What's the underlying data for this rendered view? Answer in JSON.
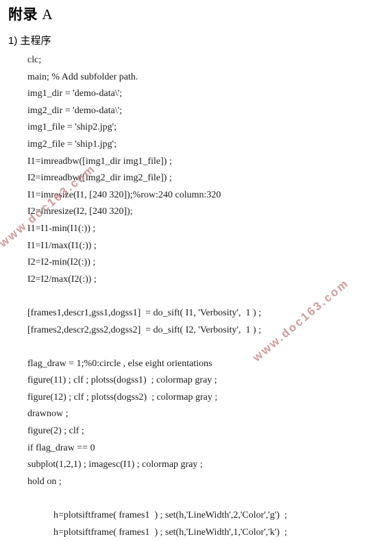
{
  "document": {
    "title_cjk": "附录",
    "title_latin": "A",
    "section_heading": "1) 主程序",
    "code_lines": [
      {
        "text": "clc;",
        "indent": false
      },
      {
        "text": "main; % Add subfolder path.",
        "indent": false
      },
      {
        "text": "img1_dir = 'demo-data\\';",
        "indent": false
      },
      {
        "text": "img2_dir = 'demo-data\\';",
        "indent": false
      },
      {
        "text": "img1_file = 'ship2.jpg';",
        "indent": false
      },
      {
        "text": "img2_file = 'ship1.jpg';",
        "indent": false
      },
      {
        "text": "I1=imreadbw([img1_dir img1_file]) ;",
        "indent": false
      },
      {
        "text": "I2=imreadbw([img2_dir img2_file]) ;",
        "indent": false
      },
      {
        "text": "I1=imresize(I1, [240 320]);%row:240 column:320",
        "indent": false
      },
      {
        "text": "I2=imresize(I2, [240 320]);",
        "indent": false
      },
      {
        "text": "I1=I1-min(I1(:)) ;",
        "indent": false
      },
      {
        "text": "I1=I1/max(I1(:)) ;",
        "indent": false
      },
      {
        "text": "I2=I2-min(I2(:)) ;",
        "indent": false
      },
      {
        "text": "I2=I2/max(I2(:)) ;",
        "indent": false
      },
      {
        "text": "",
        "indent": false
      },
      {
        "text": "[frames1,descr1,gss1,dogss1]  = do_sift( I1, 'Verbosity',  1 ) ;",
        "indent": false
      },
      {
        "text": "[frames2,descr2,gss2,dogss2]  = do_sift( I2, 'Verbosity',  1 ) ;",
        "indent": false
      },
      {
        "text": "",
        "indent": false
      },
      {
        "text": "flag_draw = 1;%0:circle , else eight orientations",
        "indent": false
      },
      {
        "text": "figure(11) ; clf ; plotss(dogss1)  ; colormap gray ;",
        "indent": false
      },
      {
        "text": "figure(12) ; clf ; plotss(dogss2)  ; colormap gray ;",
        "indent": false
      },
      {
        "text": "drawnow ;",
        "indent": false
      },
      {
        "text": "figure(2) ; clf ;",
        "indent": false
      },
      {
        "text": "if flag_draw == 0",
        "indent": false
      },
      {
        "text": "subplot(1,2,1) ; imagesc(I1) ; colormap gray ;",
        "indent": false
      },
      {
        "text": "hold on ;",
        "indent": false
      },
      {
        "text": "",
        "indent": false
      },
      {
        "text": "h=plotsiftframe( frames1  ) ; set(h,'LineWidth',2,'Color','g')  ;",
        "indent": true
      },
      {
        "text": "h=plotsiftframe( frames1  ) ; set(h,'LineWidth',1,'Color','k')  ;",
        "indent": true
      }
    ]
  },
  "watermarks": [
    {
      "text": "www.doc163.com"
    },
    {
      "text": "www.doc163.com"
    }
  ],
  "colors": {
    "page_background": "#ffffff",
    "text": "#1a1a1a",
    "watermark": "#c98a8a"
  }
}
